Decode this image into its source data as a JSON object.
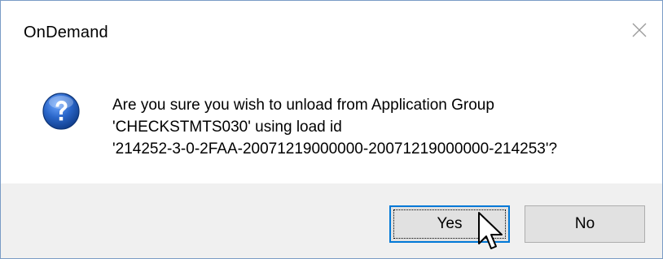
{
  "window": {
    "title": "OnDemand",
    "close_icon": "close-icon"
  },
  "message": {
    "icon": "question-icon",
    "lines": [
      "Are you sure you wish to unload from Application Group",
      "'CHECKSTMTS030' using load id",
      "'214252-3-0-2FAA-20071219000000-20071219000000-214253'?"
    ]
  },
  "buttons": {
    "yes_label": "Yes",
    "no_label": "No",
    "default": "Yes"
  },
  "colors": {
    "accent": "#0078d7",
    "icon_blue": "#1f5fbf",
    "footer_bg": "#f0f0f0",
    "button_bg": "#e1e1e1",
    "window_border": "#7a9cc6"
  },
  "cursor_icon": "mouse-pointer-icon"
}
